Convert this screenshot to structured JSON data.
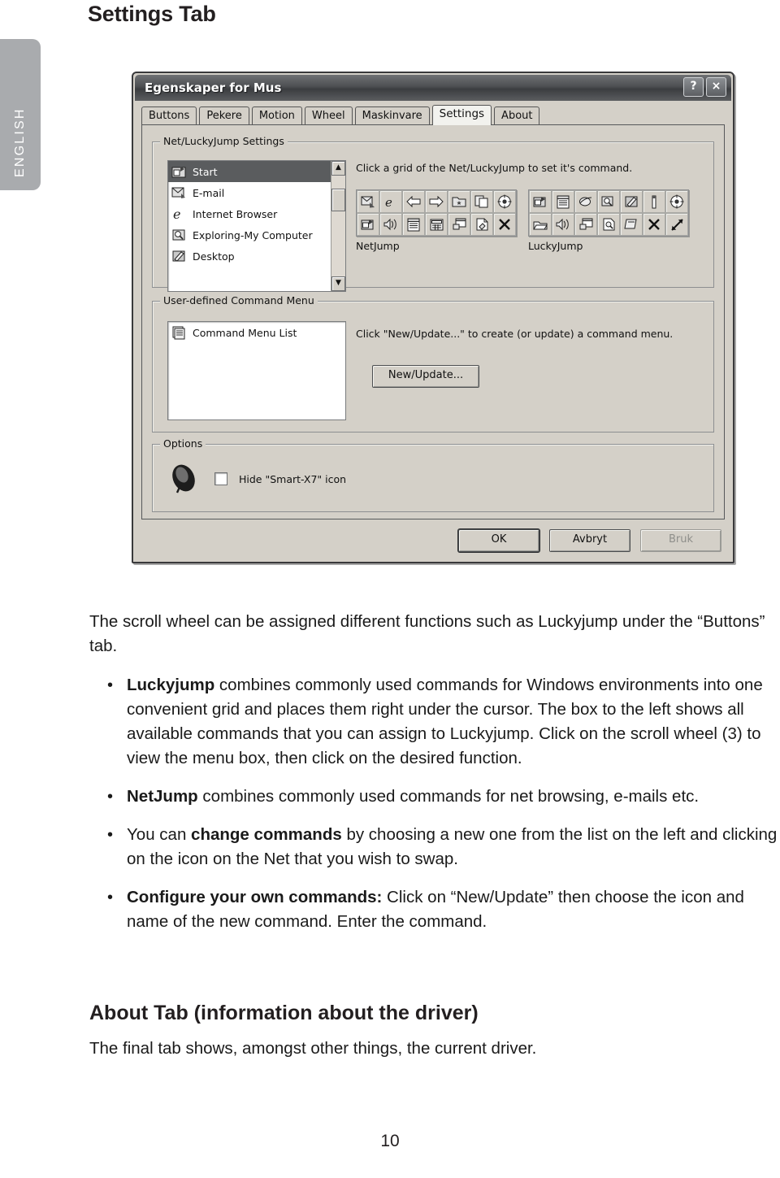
{
  "page": {
    "title": "Settings Tab",
    "language_tab": "ENGLISH",
    "number": "10"
  },
  "dialog": {
    "window_title": "Egenskaper for Mus",
    "help_button": "?",
    "close_button": "×",
    "tabs": [
      {
        "label": "Buttons",
        "active": false
      },
      {
        "label": "Pekere",
        "active": false
      },
      {
        "label": "Motion",
        "active": false
      },
      {
        "label": "Wheel",
        "active": false
      },
      {
        "label": "Maskinvare",
        "active": false
      },
      {
        "label": "Settings",
        "active": true
      },
      {
        "label": "About",
        "active": false
      }
    ],
    "net_group": {
      "legend": "Net/LuckyJump Settings",
      "hint": "Click a grid of the Net/LuckyJump to set it's command.",
      "command_list": [
        {
          "label": "Start",
          "icon": "start-icon",
          "selected": true
        },
        {
          "label": "E-mail",
          "icon": "email-icon",
          "selected": false
        },
        {
          "label": "Internet Browser",
          "icon": "browser-icon",
          "selected": false
        },
        {
          "label": "Exploring-My Computer",
          "icon": "explorer-icon",
          "selected": false
        },
        {
          "label": "Desktop",
          "icon": "desktop-icon",
          "selected": false
        }
      ],
      "netjump_label": "NetJump",
      "luckyjump_label": "LuckyJump",
      "netjump_cells": [
        "email-icon",
        "internet-explorer-icon",
        "back-arrow-icon",
        "forward-arrow-icon",
        "favorites-folder-icon",
        "copy-paste-icon",
        "target-icon",
        "start-icon",
        "volume-icon",
        "document-list-icon",
        "calculator-icon",
        "window-icon",
        "print-page-icon",
        "close-x-icon"
      ],
      "luckyjump_cells": [
        "start-icon",
        "document-list-icon",
        "browser-icon",
        "search-icon",
        "desktop-icon",
        "bar-icon",
        "target-icon",
        "folder-icon",
        "volume-icon",
        "window-icon",
        "search-doc-icon",
        "printer-page-icon",
        "close-x-icon",
        "resize-arrow-icon"
      ]
    },
    "cmd_group": {
      "legend": "User-defined Command Menu",
      "list_item": "Command Menu List",
      "list_item_icon": "menu-list-icon",
      "hint": "Click \"New/Update...\" to create (or update) a command menu.",
      "new_update_button": "New/Update..."
    },
    "options_group": {
      "legend": "Options",
      "mouse_icon": "mouse-icon",
      "checkbox_label": "Hide \"Smart-X7\" icon",
      "checkbox_checked": false
    },
    "footer": {
      "ok": "OK",
      "cancel": "Avbryt",
      "apply": "Bruk",
      "apply_disabled": true,
      "cursor": "mouse-cursor-icon"
    }
  },
  "body": {
    "intro": "The scroll wheel can be assigned different functions such as Luckyjump under the “Buttons” tab.",
    "bullets": [
      {
        "bold_lead": "Luckyjump",
        "text": " combines commonly used commands for Windows environments into one convenient grid and places them right under the cursor. The box to the left shows all available commands that you can assign to Luckyjump. Click on the scroll wheel (3) to view the menu box, then click on the desired function."
      },
      {
        "bold_lead": "NetJump",
        "text": " combines commonly used commands for net browsing, e-mails etc."
      },
      {
        "pre": "You can ",
        "bold_lead": "change commands",
        "text": " by choosing a new one from the list on the left and clicking on the icon on the Net that you wish to swap."
      },
      {
        "bold_lead": "Configure your own commands:",
        "text": " Click on “New/Update” then choose the icon and name of the new command. Enter the command.",
        "bold_mid": "New/Update"
      }
    ],
    "section_heading": "About Tab (information about the driver)",
    "section_text": "The final tab shows, amongst other things, the current driver."
  }
}
